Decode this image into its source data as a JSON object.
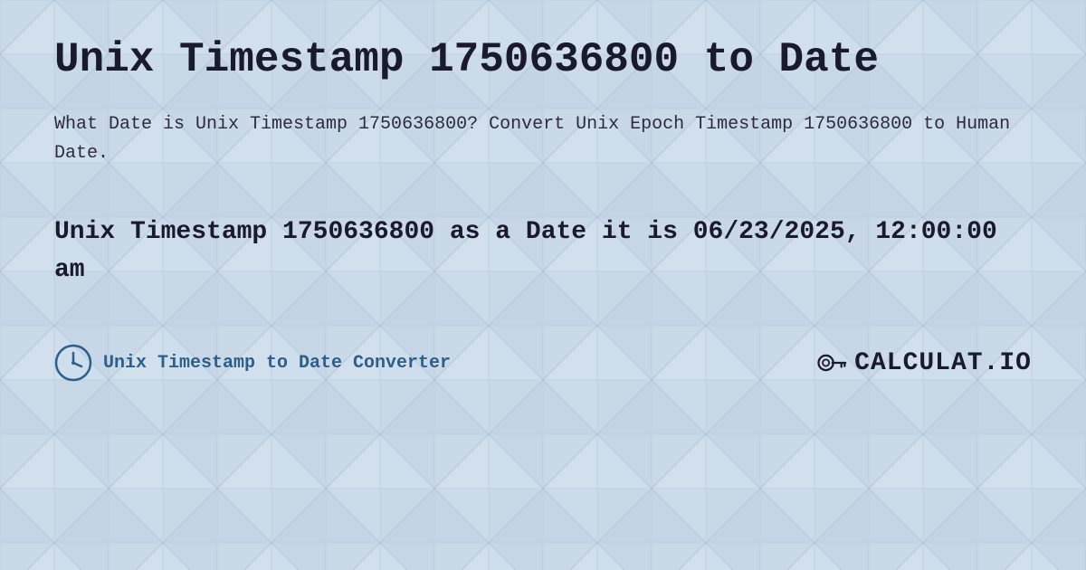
{
  "page": {
    "title": "Unix Timestamp 1750636800 to Date",
    "description": "What Date is Unix Timestamp 1750636800? Convert Unix Epoch Timestamp 1750636800 to Human Date.",
    "result": "Unix Timestamp 1750636800 as a Date it is 06/23/2025, 12:00:00 am",
    "background_color": "#c8d8e8",
    "accent_color": "#2c5f8a"
  },
  "footer": {
    "label": "Unix Timestamp to Date Converter",
    "logo_text": "CALCULAT.IO"
  }
}
